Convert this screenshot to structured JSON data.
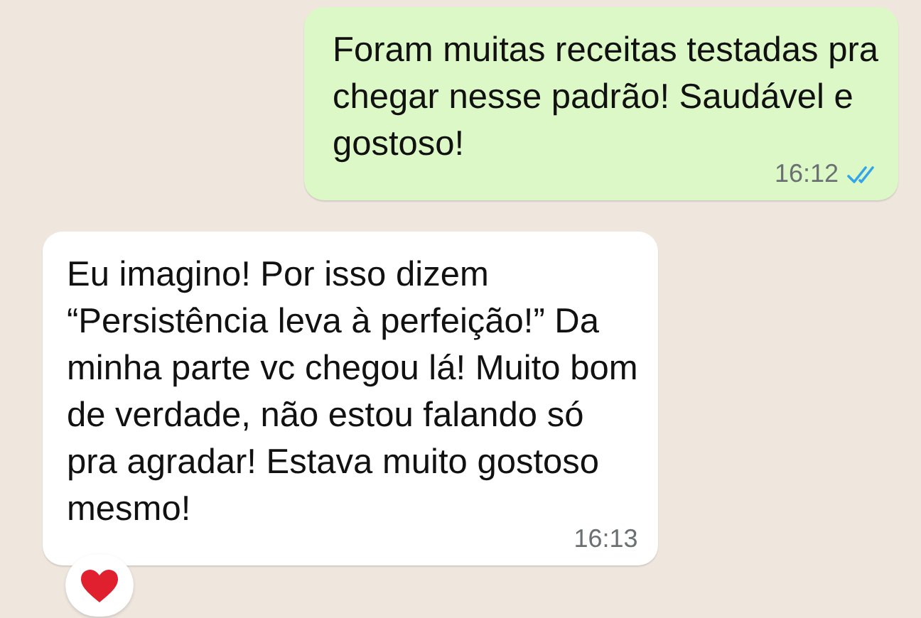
{
  "messages": [
    {
      "outgoing": true,
      "text": "Foram muitas receitas testadas pra\nchegar nesse padrão! Saudável e\ngostoso!",
      "time": "16:12",
      "read": true
    },
    {
      "outgoing": false,
      "text": "Eu imagino! Por isso dizem\n“Persistência leva à perfeição!” Da\nminha parte vc chegou lá! Muito bom\nde verdade, não estou falando só\npra agradar! Estava muito gostoso\nmesmo!",
      "time": "16:13",
      "hearted": true
    }
  ]
}
